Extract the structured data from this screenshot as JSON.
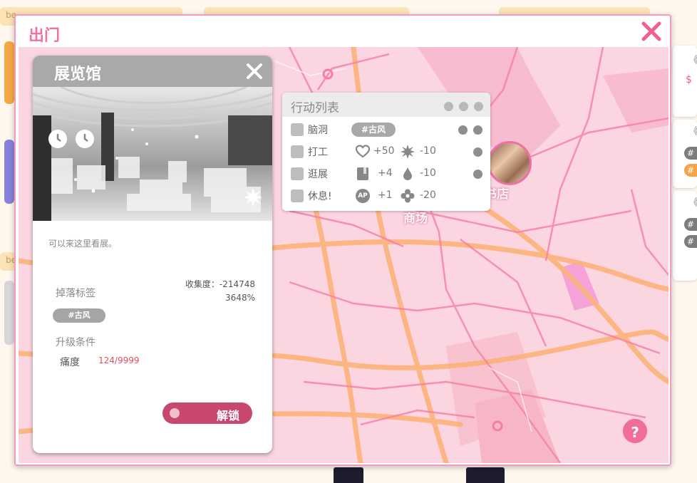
{
  "background": {
    "tab_left": "be",
    "tab_left_lower": "be",
    "chips": [
      "#",
      "#",
      "#",
      "#"
    ],
    "right_marks": [
      "《",
      "《",
      "《"
    ],
    "price_mark": "$"
  },
  "window": {
    "title": "出门"
  },
  "map": {
    "labels": {
      "store": "书店",
      "mall": "商场"
    },
    "help": "?"
  },
  "actions": {
    "title": "行动列表",
    "rows": [
      {
        "label": "脑洞",
        "tag": "#古风"
      },
      {
        "label": "打工",
        "effects": [
          {
            "icon": "heart-icon",
            "value": "+50"
          },
          {
            "icon": "burst-icon",
            "value": "-10"
          }
        ]
      },
      {
        "label": "逛展",
        "effects": [
          {
            "icon": "book-icon",
            "value": "+4"
          },
          {
            "icon": "drop-icon",
            "value": "-10"
          }
        ]
      },
      {
        "label": "休息!",
        "effects": [
          {
            "icon": "ap-icon",
            "text": "AP",
            "value": "+1"
          },
          {
            "icon": "flower-icon",
            "value": "-20"
          }
        ]
      }
    ]
  },
  "card": {
    "title": "展览馆",
    "description": "可以来这里看展。",
    "drop_label": "掉落标签",
    "collect_line1": "收集度：-214748",
    "collect_line2": "3648%",
    "drop_tag": "#古风",
    "upgrade_label": "升级条件",
    "requirement": {
      "name": "痛度",
      "value": "124/9999"
    },
    "unlock": "解锁"
  },
  "colors": {
    "accent": "#ef70a4",
    "unlock": "#c8476e",
    "map_bg": "#fbd5df",
    "road_major": "#fbb37a",
    "road_minor": "#f67ea6"
  }
}
